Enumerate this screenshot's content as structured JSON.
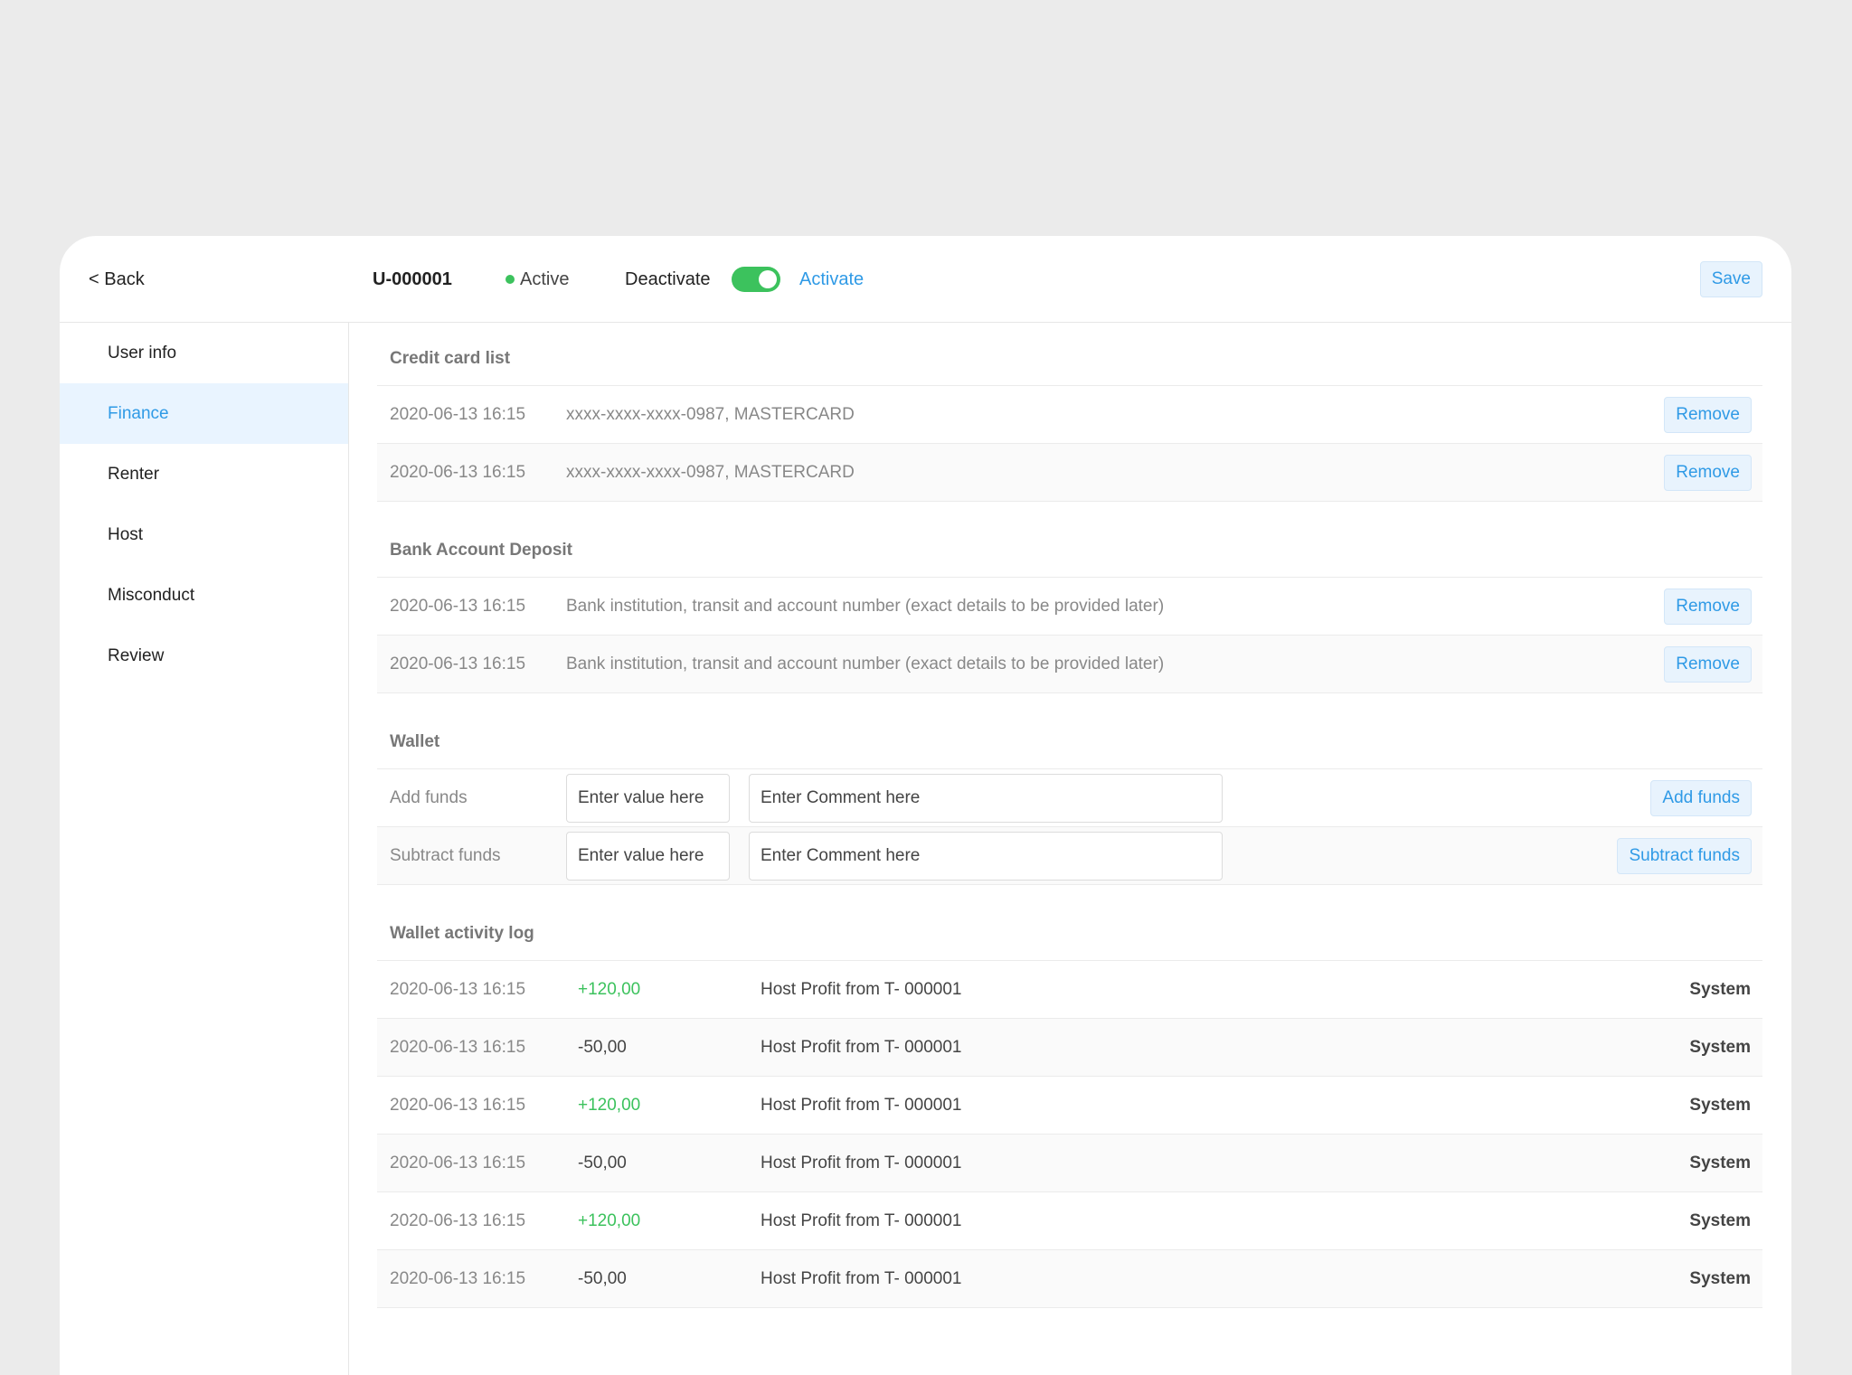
{
  "header": {
    "back_label": "< Back",
    "user_id": "U-000001",
    "status_label": "Active",
    "deactivate_label": "Deactivate",
    "activate_label": "Activate",
    "save_label": "Save",
    "toggle_on": true,
    "status_color": "#3cc25d",
    "accent_color": "#2f9ae6"
  },
  "sidebar": {
    "items": [
      {
        "label": "User info"
      },
      {
        "label": "Finance",
        "active": true
      },
      {
        "label": "Renter"
      },
      {
        "label": "Host"
      },
      {
        "label": "Misconduct"
      },
      {
        "label": "Review"
      }
    ]
  },
  "credit_cards": {
    "title": "Credit card list",
    "rows": [
      {
        "date": "2020-06-13 16:15",
        "desc": "xxxx-xxxx-xxxx-0987, MASTERCARD",
        "action": "Remove"
      },
      {
        "date": "2020-06-13 16:15",
        "desc": "xxxx-xxxx-xxxx-0987, MASTERCARD",
        "action": "Remove"
      }
    ]
  },
  "bank": {
    "title": "Bank Account Deposit",
    "rows": [
      {
        "date": "2020-06-13 16:15",
        "desc": "Bank institution, transit and account number (exact details to be provided later)",
        "action": "Remove"
      },
      {
        "date": "2020-06-13 16:15",
        "desc": "Bank institution, transit and account number (exact details to be provided later)",
        "action": "Remove"
      }
    ]
  },
  "wallet": {
    "title": "Wallet",
    "rows": [
      {
        "label": "Add funds",
        "value_placeholder": "Enter value here",
        "comment_placeholder": "Enter Comment here",
        "action": "Add funds"
      },
      {
        "label": "Subtract funds",
        "value_placeholder": "Enter value here",
        "comment_placeholder": "Enter Comment here",
        "action": "Subtract funds"
      }
    ]
  },
  "log": {
    "title": "Wallet activity log",
    "rows": [
      {
        "date": "2020-06-13 16:15",
        "amount": "+120,00",
        "desc": "Host Profit from T- 000001",
        "by": "System"
      },
      {
        "date": "2020-06-13 16:15",
        "amount": "-50,00",
        "desc": "Host Profit from T- 000001",
        "by": "System"
      },
      {
        "date": "2020-06-13 16:15",
        "amount": "+120,00",
        "desc": "Host Profit from T- 000001",
        "by": "System"
      },
      {
        "date": "2020-06-13 16:15",
        "amount": "-50,00",
        "desc": "Host Profit from T- 000001",
        "by": "System"
      },
      {
        "date": "2020-06-13 16:15",
        "amount": "+120,00",
        "desc": "Host Profit from T- 000001",
        "by": "System"
      },
      {
        "date": "2020-06-13 16:15",
        "amount": "-50,00",
        "desc": "Host Profit from T- 000001",
        "by": "System"
      }
    ]
  }
}
